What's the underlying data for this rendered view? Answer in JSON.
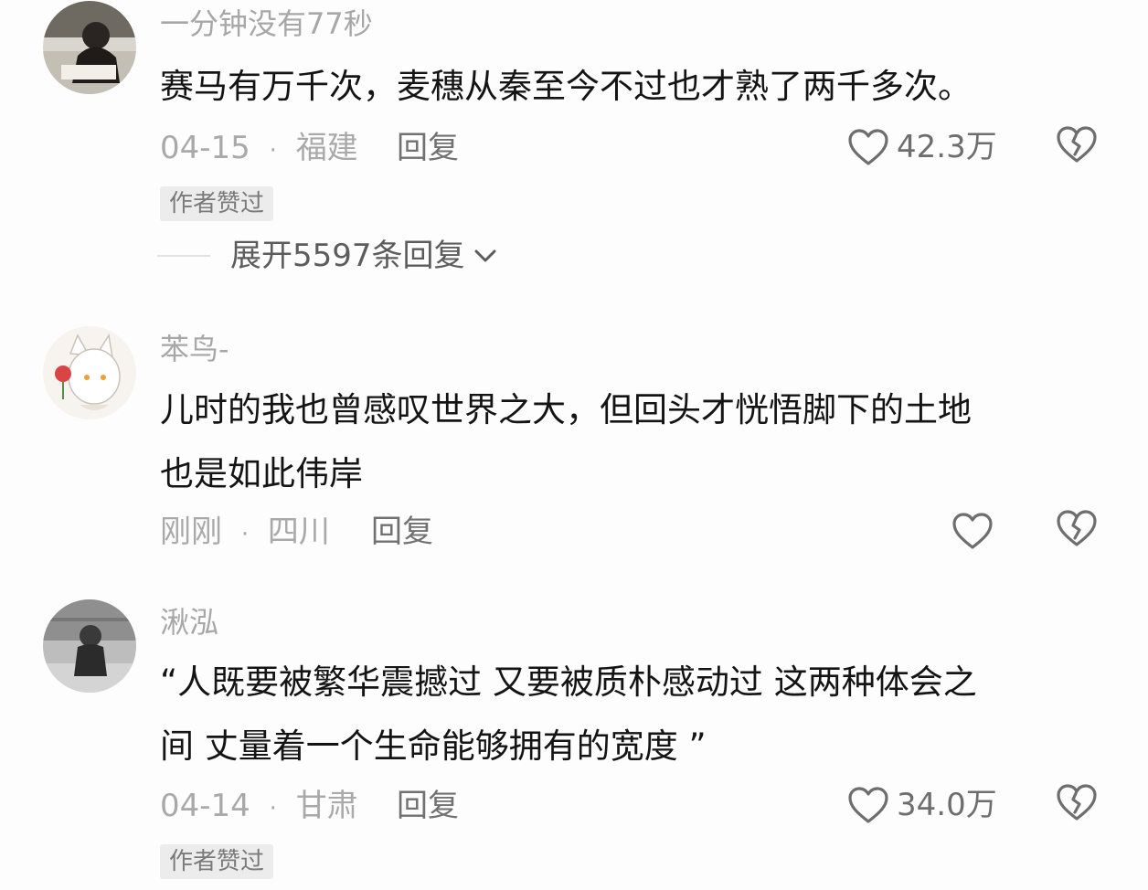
{
  "comments": [
    {
      "username": "一分钟没有77秒",
      "content": "赛马有万千次，麦穗从秦至今不过也才熟了两千多次。",
      "date": "04-15",
      "separator": "·",
      "location": "福建",
      "reply_label": "回复",
      "like_count": "42.3万",
      "badge": "作者赞过",
      "expand_label": "展开5597条回复",
      "avatar_icon": "photo-avatar-woman-studying"
    },
    {
      "username": "苯鸟-",
      "content_lines": [
        "儿时的我也曾感叹世界之大，但回头才恍悟脚下的土地",
        "也是如此伟岸"
      ],
      "date": "刚刚",
      "separator": "·",
      "location": "四川",
      "reply_label": "回复",
      "avatar_icon": "anime-cat-girl-rose-avatar"
    },
    {
      "username": "湫泓",
      "content_lines": [
        "“人既要被繁华震撼过 又要被质朴感动过 这两种体会之",
        "间 丈量着一个生命能够拥有的宽度 ”"
      ],
      "date": "04-14",
      "separator": "·",
      "location": "甘肃",
      "reply_label": "回复",
      "like_count": "34.0万",
      "badge": "作者赞过",
      "avatar_icon": "photo-avatar-grayscale-child"
    }
  ],
  "icons": {
    "like": "heart-outline-icon",
    "dislike": "broken-heart-icon",
    "expand": "chevron-down-icon"
  },
  "colors": {
    "background": "#fdfdfd",
    "text": "#141414",
    "muted": "#a9a9a9",
    "icon": "#6e6e6e",
    "badge_bg": "#ececec"
  }
}
